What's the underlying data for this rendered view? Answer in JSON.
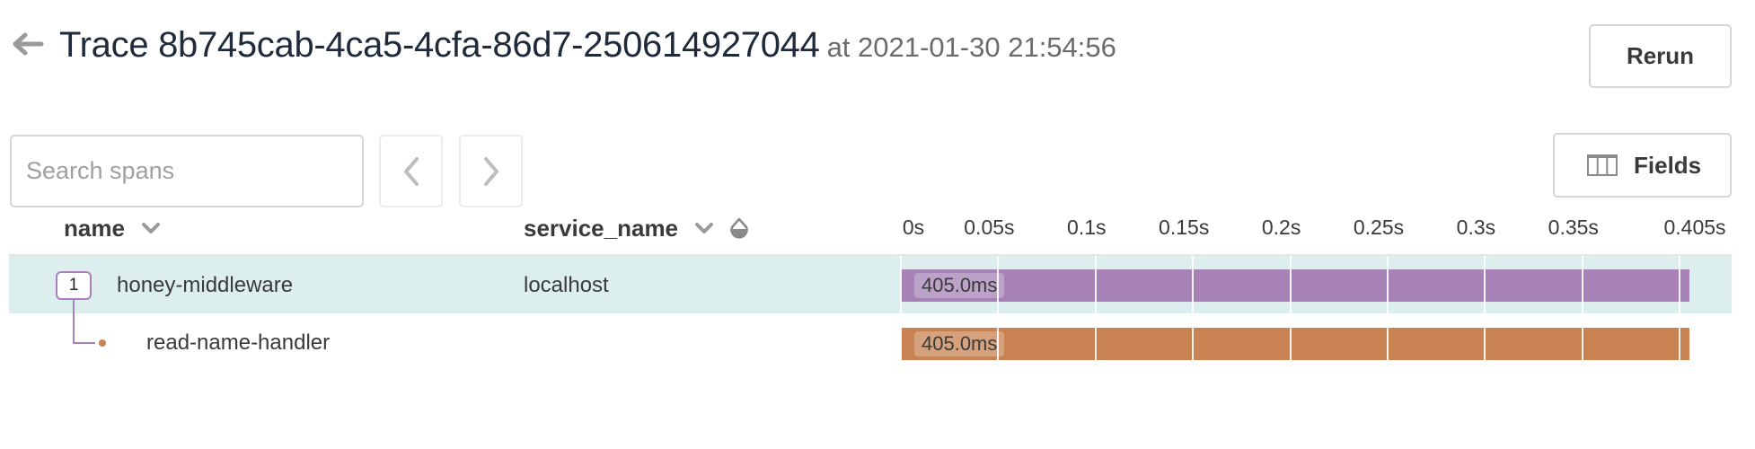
{
  "header": {
    "back_icon": "arrow-left-icon",
    "title": "Trace 8b745cab-4ca5-4cfa-86d7-250614927044",
    "timestamp": "at 2021-01-30 21:54:56",
    "rerun_label": "Rerun"
  },
  "toolbar": {
    "search_placeholder": "Search spans",
    "search_value": "",
    "prev_icon": "chevron-left-icon",
    "next_icon": "chevron-right-icon",
    "fields_label": "Fields",
    "fields_icon": "columns-icon"
  },
  "columns": {
    "name": {
      "label": "name",
      "icon": "chevron-down-icon"
    },
    "service_name": {
      "label": "service_name",
      "icon": "chevron-down-icon",
      "color_icon": "color-drop-icon"
    }
  },
  "timeline": {
    "total_s": 0.405,
    "ticks": [
      {
        "value": 0,
        "label": "0s"
      },
      {
        "value": 0.05,
        "label": "0.05s"
      },
      {
        "value": 0.1,
        "label": "0.1s"
      },
      {
        "value": 0.15,
        "label": "0.15s"
      },
      {
        "value": 0.2,
        "label": "0.2s"
      },
      {
        "value": 0.25,
        "label": "0.25s"
      },
      {
        "value": 0.3,
        "label": "0.3s"
      },
      {
        "value": 0.35,
        "label": "0.35s"
      },
      {
        "value": 0.405,
        "label": "0.405s"
      }
    ],
    "gridlines": [
      0,
      0.05,
      0.1,
      0.15,
      0.2,
      0.25,
      0.3,
      0.35,
      0.4
    ]
  },
  "spans": [
    {
      "name": "honey-middleware",
      "service_name": "localhost",
      "child_count": "1",
      "start_s": 0,
      "duration_s": 0.405,
      "duration_label": "405.0ms",
      "color": "#a682b6",
      "selected": true
    },
    {
      "name": "read-name-handler",
      "service_name": "",
      "start_s": 0,
      "duration_s": 0.405,
      "duration_label": "405.0ms",
      "color": "#c98352",
      "selected": false
    }
  ],
  "colors": {
    "selected_row_bg": "#dceeee",
    "title_text": "#1f2a3a",
    "tree_line": "#a682b6"
  }
}
